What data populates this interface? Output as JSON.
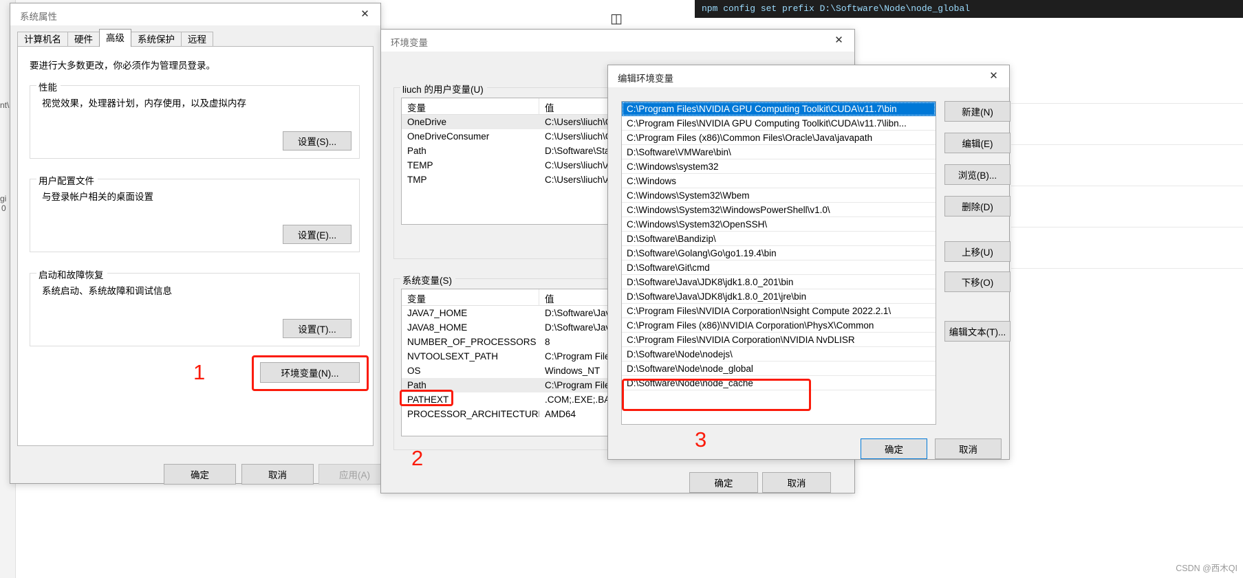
{
  "background": {
    "code_line": "npm config set prefix D:\\Software\\Node\\node_global",
    "split_icon": "◫",
    "side_labels": [
      "nt\\",
      "gi",
      "0"
    ],
    "watermark": "CSDN @西木QI"
  },
  "system_properties": {
    "title": "系统属性",
    "close_icon": "✕",
    "tabs": [
      {
        "label": "计算机名",
        "active": false
      },
      {
        "label": "硬件",
        "active": false
      },
      {
        "label": "高级",
        "active": true
      },
      {
        "label": "系统保护",
        "active": false
      },
      {
        "label": "远程",
        "active": false
      }
    ],
    "intro": "要进行大多数更改，你必须作为管理员登录。",
    "groups": [
      {
        "title": "性能",
        "desc": "视觉效果，处理器计划，内存使用，以及虚拟内存",
        "button": "设置(S)..."
      },
      {
        "title": "用户配置文件",
        "desc": "与登录帐户相关的桌面设置",
        "button": "设置(E)..."
      },
      {
        "title": "启动和故障恢复",
        "desc": "系统启动、系统故障和调试信息",
        "button": "设置(T)..."
      }
    ],
    "env_button": "环境变量(N)...",
    "footer": {
      "ok": "确定",
      "cancel": "取消",
      "apply": "应用(A)"
    },
    "annotation_number": "1"
  },
  "environment_variables": {
    "title": "环境变量",
    "close_icon": "✕",
    "user_group_title": "liuch 的用户变量(U)",
    "columns": {
      "variable": "变量",
      "value": "值"
    },
    "user_vars": [
      {
        "name": "OneDrive",
        "value": "C:\\Users\\liuch\\On",
        "selected": true
      },
      {
        "name": "OneDriveConsumer",
        "value": "C:\\Users\\liuch\\On",
        "selected": false
      },
      {
        "name": "Path",
        "value": "D:\\Software\\Stab",
        "selected": false
      },
      {
        "name": "TEMP",
        "value": "C:\\Users\\liuch\\Ap",
        "selected": false
      },
      {
        "name": "TMP",
        "value": "C:\\Users\\liuch\\Ap",
        "selected": false
      }
    ],
    "system_group_title": "系统变量(S)",
    "system_vars": [
      {
        "name": "JAVA7_HOME",
        "value": "D:\\Software\\Java\\",
        "selected": false
      },
      {
        "name": "JAVA8_HOME",
        "value": "D:\\Software\\Java\\",
        "selected": false
      },
      {
        "name": "NUMBER_OF_PROCESSORS",
        "value": "8",
        "selected": false
      },
      {
        "name": "NVTOOLSEXT_PATH",
        "value": "C:\\Program Files\\",
        "selected": false
      },
      {
        "name": "OS",
        "value": "Windows_NT",
        "selected": false
      },
      {
        "name": "Path",
        "value": "C:\\Program Files\\",
        "selected": true
      },
      {
        "name": "PATHEXT",
        "value": ".COM;.EXE;.BAT;.C",
        "selected": false
      },
      {
        "name": "PROCESSOR_ARCHITECTURE",
        "value": "AMD64",
        "selected": false
      }
    ],
    "footer": {
      "ok": "确定",
      "cancel": "取消"
    },
    "annotation_number": "2"
  },
  "edit_environment_variable": {
    "title": "编辑环境变量",
    "close_icon": "✕",
    "entries": [
      {
        "path": "C:\\Program Files\\NVIDIA GPU Computing Toolkit\\CUDA\\v11.7\\bin",
        "selected": true,
        "highlighted": false
      },
      {
        "path": "C:\\Program Files\\NVIDIA GPU Computing Toolkit\\CUDA\\v11.7\\libn...",
        "selected": false,
        "highlighted": false
      },
      {
        "path": "C:\\Program Files (x86)\\Common Files\\Oracle\\Java\\javapath",
        "selected": false,
        "highlighted": false
      },
      {
        "path": "D:\\Software\\VMWare\\bin\\",
        "selected": false,
        "highlighted": false
      },
      {
        "path": "C:\\Windows\\system32",
        "selected": false,
        "highlighted": false
      },
      {
        "path": "C:\\Windows",
        "selected": false,
        "highlighted": false
      },
      {
        "path": "C:\\Windows\\System32\\Wbem",
        "selected": false,
        "highlighted": false
      },
      {
        "path": "C:\\Windows\\System32\\WindowsPowerShell\\v1.0\\",
        "selected": false,
        "highlighted": false
      },
      {
        "path": "C:\\Windows\\System32\\OpenSSH\\",
        "selected": false,
        "highlighted": false
      },
      {
        "path": "D:\\Software\\Bandizip\\",
        "selected": false,
        "highlighted": false
      },
      {
        "path": "D:\\Software\\Golang\\Go\\go1.19.4\\bin",
        "selected": false,
        "highlighted": false
      },
      {
        "path": "D:\\Software\\Git\\cmd",
        "selected": false,
        "highlighted": false
      },
      {
        "path": "D:\\Software\\Java\\JDK8\\jdk1.8.0_201\\bin",
        "selected": false,
        "highlighted": false
      },
      {
        "path": "D:\\Software\\Java\\JDK8\\jdk1.8.0_201\\jre\\bin",
        "selected": false,
        "highlighted": false
      },
      {
        "path": "C:\\Program Files\\NVIDIA Corporation\\Nsight Compute 2022.2.1\\",
        "selected": false,
        "highlighted": false
      },
      {
        "path": "C:\\Program Files (x86)\\NVIDIA Corporation\\PhysX\\Common",
        "selected": false,
        "highlighted": false
      },
      {
        "path": "C:\\Program Files\\NVIDIA Corporation\\NVIDIA NvDLISR",
        "selected": false,
        "highlighted": false
      },
      {
        "path": "D:\\Software\\Node\\nodejs\\",
        "selected": false,
        "highlighted": false
      },
      {
        "path": "D:\\Software\\Node\\node_global",
        "selected": false,
        "highlighted": true
      },
      {
        "path": "D:\\Software\\Node\\node_cache",
        "selected": false,
        "highlighted": true
      }
    ],
    "side_buttons": [
      "新建(N)",
      "编辑(E)",
      "浏览(B)...",
      "删除(D)",
      "上移(U)",
      "下移(O)",
      "编辑文本(T)..."
    ],
    "footer": {
      "ok": "确定",
      "cancel": "取消"
    },
    "annotation_number": "3"
  }
}
